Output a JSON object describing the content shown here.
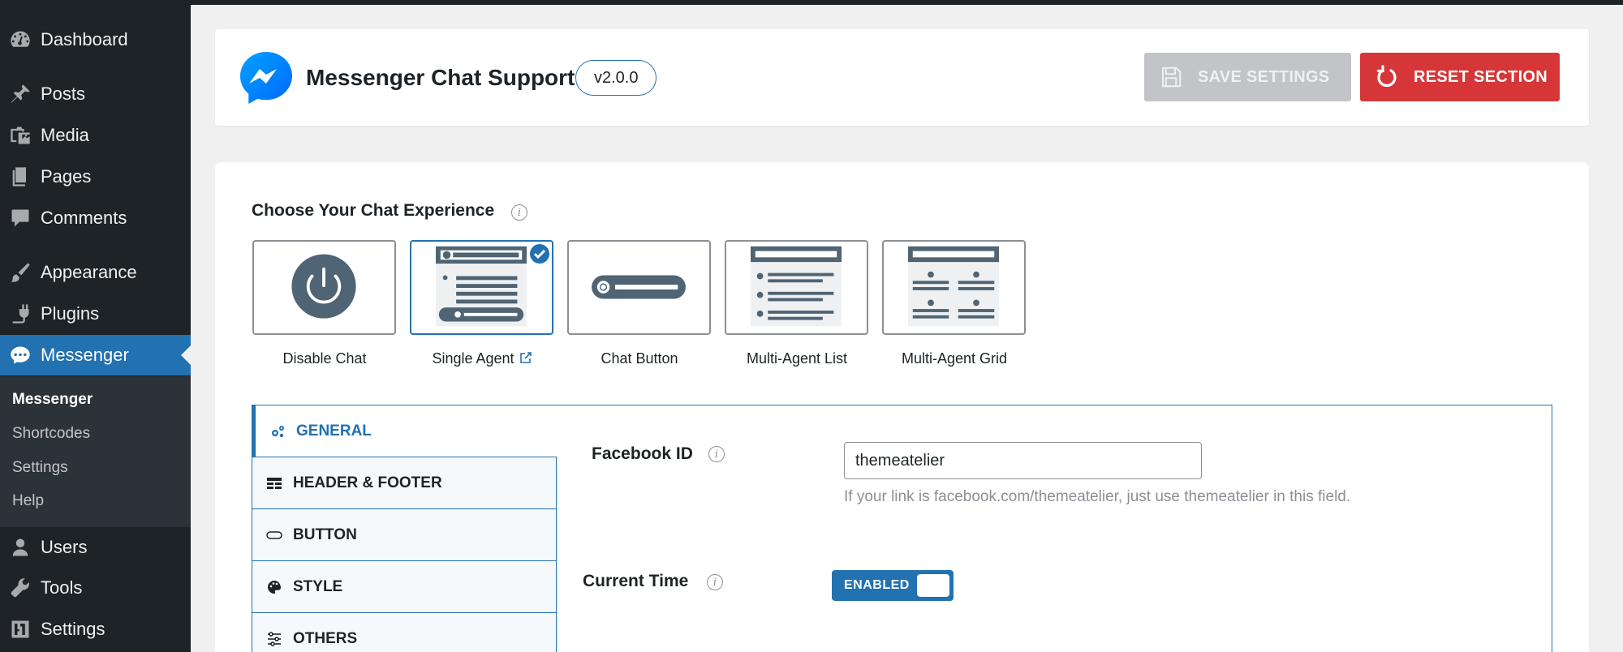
{
  "sidebar": {
    "items": [
      {
        "label": "Dashboard",
        "icon": "dashboard-icon"
      },
      {
        "label": "Posts",
        "icon": "pin-icon"
      },
      {
        "label": "Media",
        "icon": "media-icon"
      },
      {
        "label": "Pages",
        "icon": "pages-icon"
      },
      {
        "label": "Comments",
        "icon": "comment-icon"
      },
      {
        "label": "Appearance",
        "icon": "brush-icon"
      },
      {
        "label": "Plugins",
        "icon": "plugin-icon"
      },
      {
        "label": "Messenger",
        "icon": "messenger-icon",
        "active": true
      },
      {
        "label": "Users",
        "icon": "user-icon"
      },
      {
        "label": "Tools",
        "icon": "wrench-icon"
      },
      {
        "label": "Settings",
        "icon": "settings-icon"
      }
    ],
    "submenu": [
      "Messenger",
      "Shortcodes",
      "Settings",
      "Help"
    ]
  },
  "header": {
    "title": "Messenger Chat Support",
    "version": "v2.0.0",
    "save_label": "SAVE SETTINGS",
    "reset_label": "RESET SECTION"
  },
  "experience": {
    "title": "Choose Your Chat Experience",
    "options": [
      {
        "label": "Disable Chat",
        "selected": false
      },
      {
        "label": "Single Agent",
        "selected": true
      },
      {
        "label": "Chat Button",
        "selected": false
      },
      {
        "label": "Multi-Agent List",
        "selected": false
      },
      {
        "label": "Multi-Agent Grid",
        "selected": false
      }
    ]
  },
  "tabs": [
    {
      "label": "GENERAL",
      "icon": "gears-icon",
      "active": true
    },
    {
      "label": "HEADER & FOOTER",
      "icon": "layout-icon"
    },
    {
      "label": "BUTTON",
      "icon": "pill-icon"
    },
    {
      "label": "STYLE",
      "icon": "palette-icon"
    },
    {
      "label": "OTHERS",
      "icon": "sliders-icon"
    }
  ],
  "general": {
    "facebook_id_label": "Facebook ID",
    "facebook_id_value": "themeatelier",
    "facebook_id_help": "If your link is facebook.com/themeatelier, just use themeatelier in this field.",
    "current_time_label": "Current Time",
    "current_time_toggle": "ENABLED"
  },
  "colors": {
    "accent": "#2271b1",
    "danger": "#d63638",
    "sidebar_bg": "#1d2327",
    "disabled": "#c3c4c7"
  }
}
